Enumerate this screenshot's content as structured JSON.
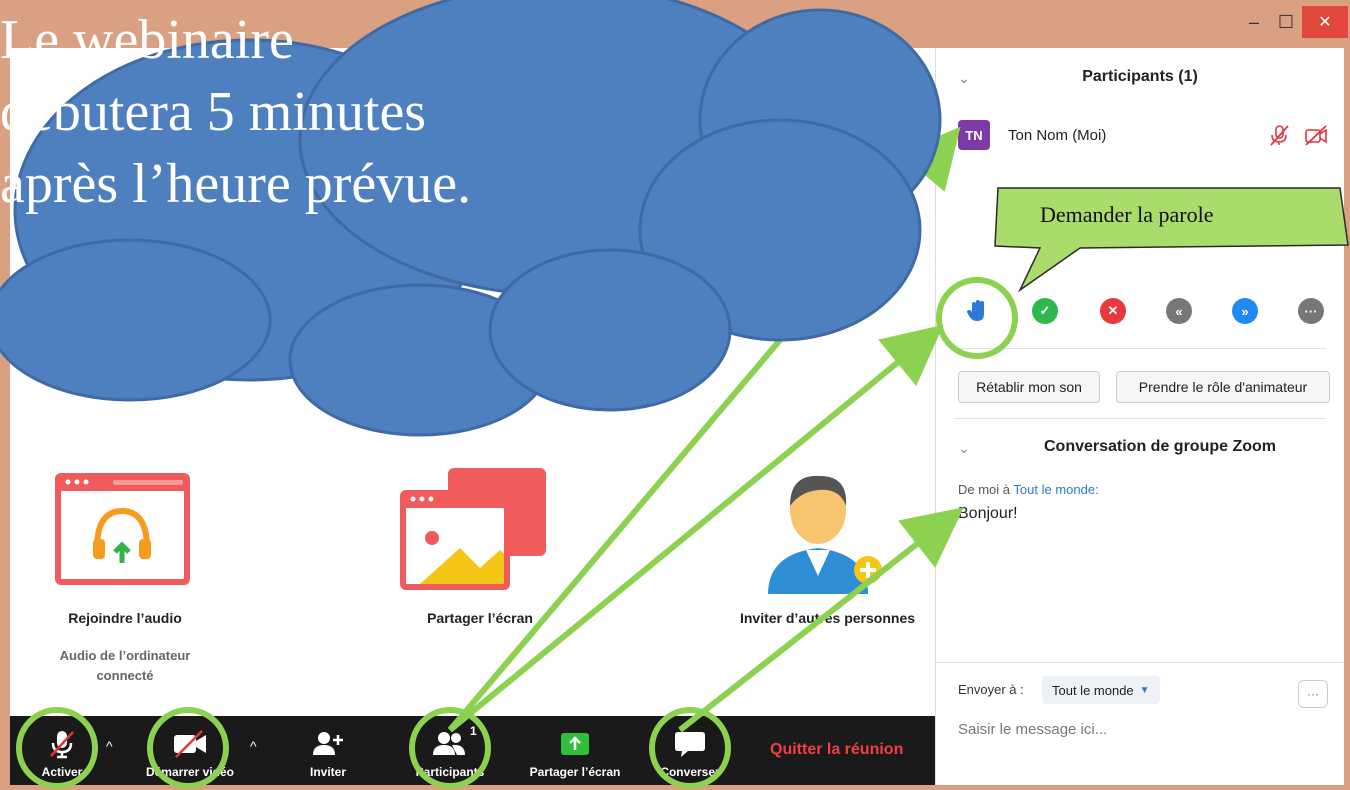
{
  "window": {
    "min": "–",
    "max": "☐",
    "close": "✕"
  },
  "participants": {
    "header": "Participants (1)",
    "list": [
      {
        "initials": "TN",
        "name": "Ton Nom (Moi)"
      }
    ],
    "buttons": {
      "unmute": "Rétablir mon son",
      "host": "Prendre le rôle d'animateur"
    }
  },
  "chat": {
    "header": "Conversation de groupe Zoom",
    "from_prefix": "De moi à",
    "from_target": "Tout le monde:",
    "message": "Bonjour!",
    "send_label": "Envoyer à :",
    "send_to": "Tout le monde",
    "input_placeholder": "Saisir le message ici..."
  },
  "hub": {
    "audio": {
      "label": "Rejoindre l’audio",
      "sub1": "Audio de l’ordinateur",
      "sub2": "connecté"
    },
    "share": {
      "label": "Partager l’écran"
    },
    "invite": {
      "label": "Inviter d’autres personnes"
    }
  },
  "toolbar": {
    "mute": "Activer",
    "video": "Démarrer vidéo",
    "invite": "Inviter",
    "participants": "Participants",
    "participants_count": "1",
    "share": "Partager l’écran",
    "chat": "Converser",
    "leave": "Quitter la réunion"
  },
  "annotations": {
    "cloud": [
      "Le webinaire",
      "débutera 5 minutes",
      "après l’heure prévue."
    ],
    "callout": "Demander la parole"
  },
  "colors": {
    "cloud": "#4e7fbf",
    "arrow": "#8dd151",
    "accent": "#2d7ad6",
    "quit": "#f23f3f"
  }
}
